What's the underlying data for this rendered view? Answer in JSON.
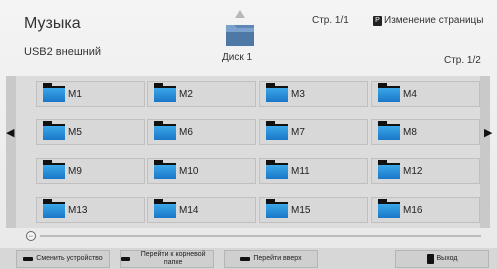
{
  "header": {
    "title": "Музыка",
    "device": "USB2 внешний",
    "drive_label": "Диск 1",
    "page_top": "Стр. 1/1",
    "page_change_label": "Изменение страницы",
    "page_right": "Стр. 1/2",
    "page_change_key": "P"
  },
  "tiles": [
    "M1",
    "M2",
    "M3",
    "M4",
    "M5",
    "M6",
    "M7",
    "M8",
    "M9",
    "M10",
    "M11",
    "M12",
    "M13",
    "M14",
    "M15",
    "M16"
  ],
  "footer": {
    "change_device": "Сменить устройство",
    "go_root": "Перейти к корневой папке",
    "go_up": "Перейти вверх",
    "exit": "Выход"
  },
  "arrows": {
    "left": "◀",
    "right": "▶",
    "up": "▲"
  },
  "scroll_handle_glyph": "↔"
}
